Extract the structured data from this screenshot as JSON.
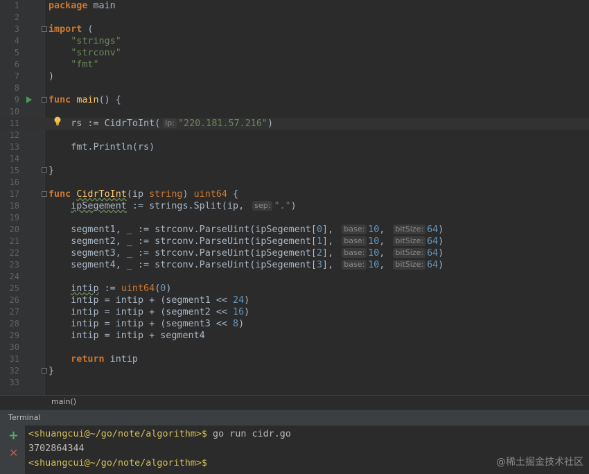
{
  "editor": {
    "line_numbers": [
      "1",
      "2",
      "3",
      "4",
      "5",
      "6",
      "7",
      "8",
      "9",
      "10",
      "11",
      "12",
      "13",
      "14",
      "15",
      "16",
      "17",
      "18",
      "19",
      "20",
      "21",
      "22",
      "23",
      "24",
      "25",
      "26",
      "27",
      "28",
      "29",
      "30",
      "31",
      "32",
      "33"
    ],
    "code": {
      "l1_kw": "package",
      "l1_rest": " main",
      "l3_kw": "import",
      "l3_rest": " (",
      "l4": "\"strings\"",
      "l5": "\"strconv\"",
      "l6": "\"fmt\"",
      "l7": ")",
      "l9_kw": "func",
      "l9_fn": "main",
      "l9_rest": "() {",
      "l11_a": "rs := CidrToInt(",
      "l11_hint": "ip:",
      "l11_str": "\"220.181.57.216\"",
      "l11_b": ")",
      "l13": "fmt.Println(rs)",
      "l15": "}",
      "l17_kw": "func",
      "l17_fn": "CidrToInt",
      "l17_a": "(ip ",
      "l17_t1": "string",
      "l17_b": ") ",
      "l17_t2": "uint64",
      "l17_c": " {",
      "l18_var": "ipSegement",
      "l18_a": " := strings.Split(ip, ",
      "l18_hint": "sep:",
      "l18_str": "\".\"",
      "l18_b": ")",
      "seg_rows": [
        {
          "a": "segment1, _ := strconv.ParseUint(ipSegement[",
          "idx": "0",
          "b": "], ",
          "hint_base": "base:",
          "base": "10",
          "c": ", ",
          "hint_bits": "bitSize:",
          "bits": "64",
          "d": ")"
        },
        {
          "a": "segment2, _ := strconv.ParseUint(ipSegement[",
          "idx": "1",
          "b": "], ",
          "hint_base": "base:",
          "base": "10",
          "c": ", ",
          "hint_bits": "bitSize:",
          "bits": "64",
          "d": ")"
        },
        {
          "a": "segment3, _ := strconv.ParseUint(ipSegement[",
          "idx": "2",
          "b": "], ",
          "hint_base": "base:",
          "base": "10",
          "c": ", ",
          "hint_bits": "bitSize:",
          "bits": "64",
          "d": ")"
        },
        {
          "a": "segment4, _ := strconv.ParseUint(ipSegement[",
          "idx": "3",
          "b": "], ",
          "hint_base": "base:",
          "base": "10",
          "c": ", ",
          "hint_bits": "bitSize:",
          "bits": "64",
          "d": ")"
        }
      ],
      "l25_var": "intip",
      "l25_a": " := ",
      "l25_t": "uint64",
      "l25_b": "(",
      "l25_n": "0",
      "l25_c": ")",
      "l26_a": "intip = intip + (segment1 << ",
      "l26_n": "24",
      "l26_b": ")",
      "l27_a": "intip = intip + (segment2 << ",
      "l27_n": "16",
      "l27_b": ")",
      "l28_a": "intip = intip + (segment3 << ",
      "l28_n": "8",
      "l28_b": ")",
      "l29": "intip = intip + segment4",
      "l31_kw": "return",
      "l31_rest": " intip",
      "l32": "}"
    },
    "breadcrumb": "main()"
  },
  "terminal": {
    "title": "Terminal",
    "prompt1": "<shuangcui@~/go/note/algorithm>$",
    "cmd1": " go run cidr.go",
    "output": "3702864344",
    "prompt2": "<shuangcui@~/go/note/algorithm>$"
  },
  "watermark": "@稀土掘金技术社区",
  "colors": {
    "keyword": "#cc7832",
    "string": "#6a8759",
    "number": "#6897bb",
    "function": "#ffc66d",
    "prompt": "#d2c057",
    "background": "#2b2b2b"
  }
}
